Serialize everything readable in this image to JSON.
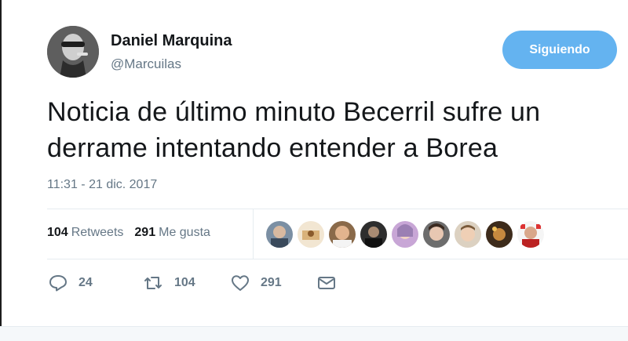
{
  "tweet": {
    "author_name": "Daniel Marquina",
    "author_handle": "@Marcuilas",
    "follow_label": "Siguiendo",
    "text_line1": "Noticia de último minuto Becerril sufre un",
    "text_line2": "derrame intentando entender a Borea",
    "timestamp": "11:31 - 21 dic. 2017"
  },
  "stats": {
    "retweets_count": "104",
    "retweets_label": "Retweets",
    "likes_count": "291",
    "likes_label": "Me gusta"
  },
  "actions": {
    "reply_count": "24",
    "retweet_count": "104",
    "like_count": "291"
  },
  "colors": {
    "accent": "#64b3f0",
    "secondary_text": "#657786",
    "divider": "#e6ecf0"
  },
  "icons": [
    "reply-icon",
    "retweet-icon",
    "like-icon",
    "message-icon"
  ]
}
